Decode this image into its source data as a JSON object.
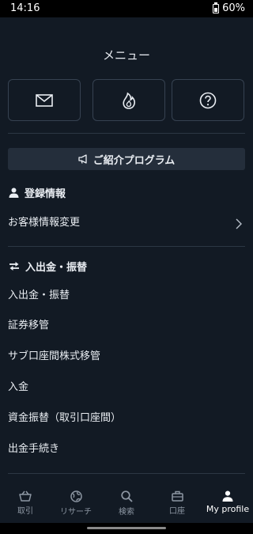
{
  "status": {
    "time": "14:16",
    "battery": "60%"
  },
  "header": {
    "title": "メニュー"
  },
  "quick_actions": [
    {
      "icon": "mail-icon"
    },
    {
      "icon": "flame-icon"
    },
    {
      "icon": "help-icon"
    }
  ],
  "referral": {
    "label": "ご紹介プログラム",
    "icon": "megaphone-icon"
  },
  "sections": {
    "registration": {
      "title": "登録情報",
      "items": [
        "お客様情報変更"
      ]
    },
    "transfer": {
      "title": "入出金・振替",
      "items": [
        "入出金・振替",
        "証券移管",
        "サブ口座間株式移管",
        "入金",
        "資金振替（取引口座間）",
        "出金手続き"
      ]
    }
  },
  "bottom_nav": [
    {
      "label": "取引",
      "icon": "basket-icon",
      "active": false
    },
    {
      "label": "リサーチ",
      "icon": "globe-icon",
      "active": false
    },
    {
      "label": "検索",
      "icon": "search-icon",
      "active": false
    },
    {
      "label": "口座",
      "icon": "briefcase-icon",
      "active": false
    },
    {
      "label": "My profile",
      "icon": "person-icon",
      "active": true
    }
  ]
}
